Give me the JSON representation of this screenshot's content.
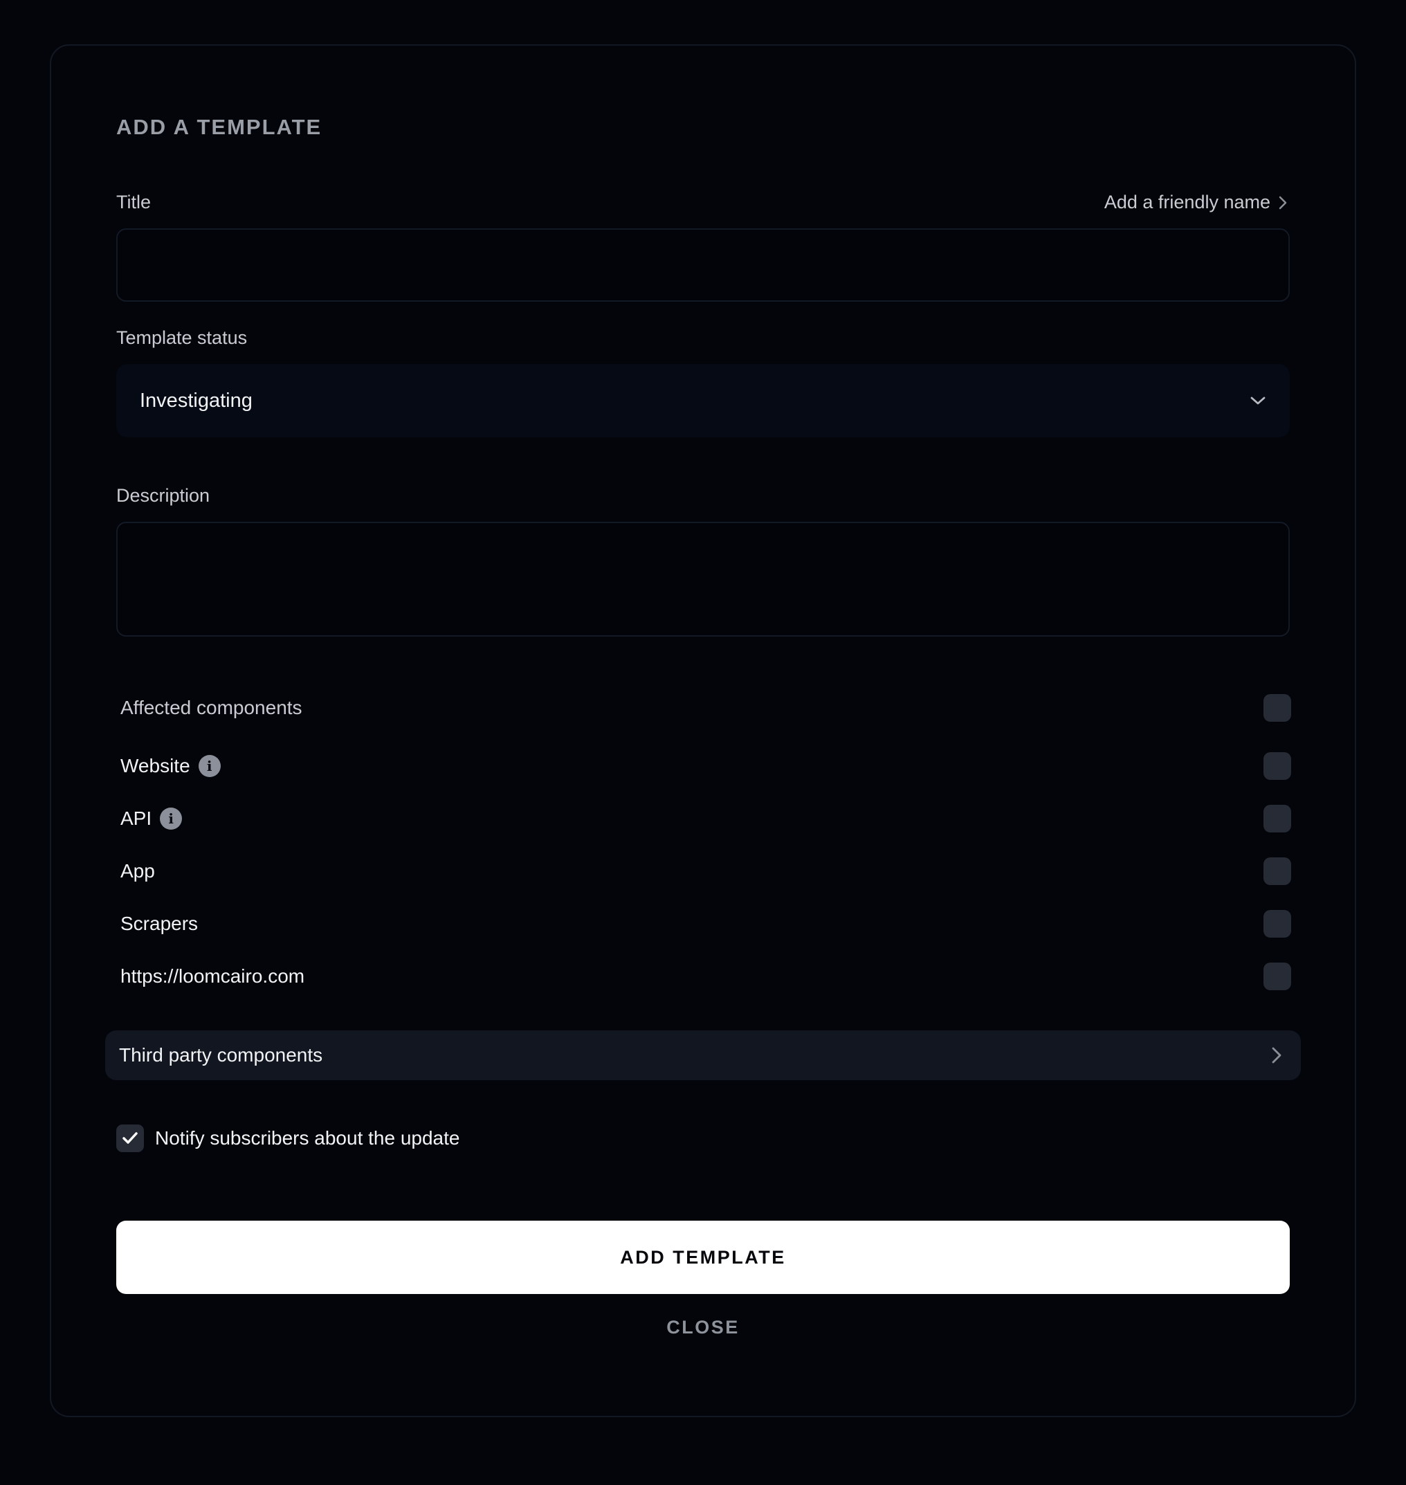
{
  "dialog": {
    "heading": "ADD A TEMPLATE",
    "title_field": {
      "label": "Title",
      "helper_link": "Add a friendly name",
      "value": "",
      "placeholder": ""
    },
    "status_field": {
      "label": "Template status",
      "selected": "Investigating"
    },
    "description_field": {
      "label": "Description",
      "value": "",
      "placeholder": ""
    },
    "components": {
      "header": "Affected components",
      "header_checked": false,
      "items": [
        {
          "label": "Website",
          "info": true,
          "checked": false
        },
        {
          "label": "API",
          "info": true,
          "checked": false
        },
        {
          "label": "App",
          "info": false,
          "checked": false
        },
        {
          "label": "Scrapers",
          "info": false,
          "checked": false
        },
        {
          "label": "https://loomcairo.com",
          "info": false,
          "checked": false
        }
      ]
    },
    "third_party": {
      "label": "Third party components"
    },
    "notify": {
      "label": "Notify subscribers about the update",
      "checked": true
    },
    "actions": {
      "primary_label": "ADD TEMPLATE",
      "secondary_label": "CLOSE"
    },
    "icons": {
      "info": "i"
    }
  }
}
